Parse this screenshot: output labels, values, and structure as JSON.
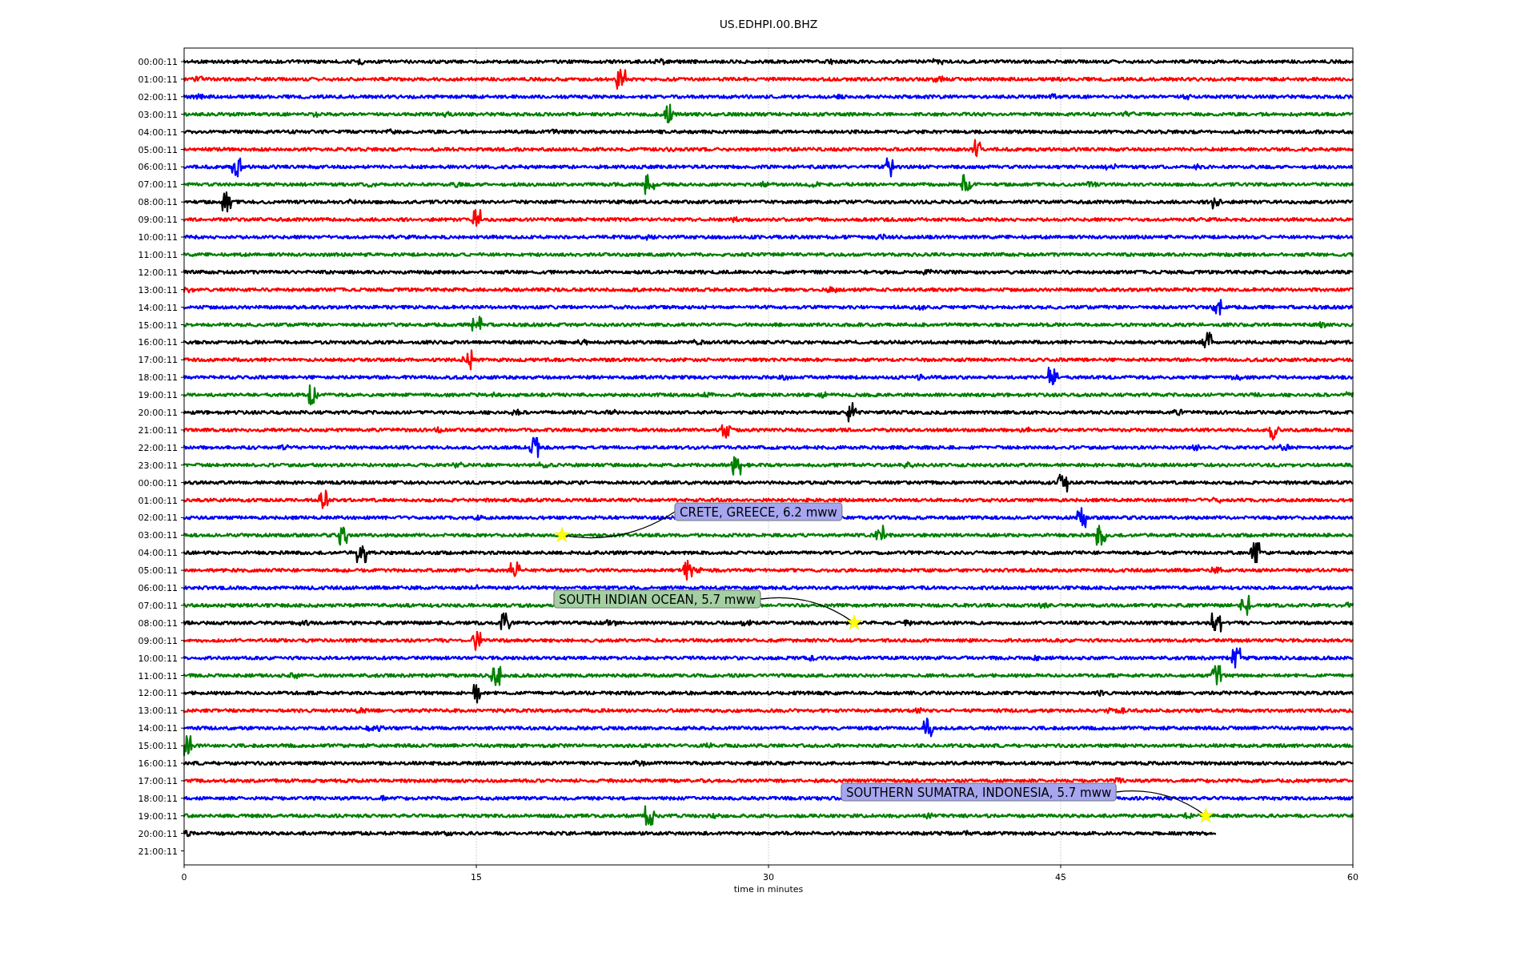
{
  "plot": {
    "title": "US.EDHPI.00.BHZ",
    "xlabel": "time in minutes",
    "xticks": [
      "0",
      "15",
      "30",
      "45",
      "60"
    ],
    "rows": [
      {
        "label": "00:00:11",
        "color": "#000000",
        "level": 1
      },
      {
        "label": "01:00:11",
        "color": "#ff0000",
        "level": 1
      },
      {
        "label": "02:00:11",
        "color": "#0000ff",
        "level": 1
      },
      {
        "label": "03:00:11",
        "color": "#008000",
        "level": 1
      },
      {
        "label": "04:00:11",
        "color": "#000000",
        "level": 1
      },
      {
        "label": "05:00:11",
        "color": "#ff0000",
        "level": 1
      },
      {
        "label": "06:00:11",
        "color": "#0000ff",
        "level": 1
      },
      {
        "label": "07:00:11",
        "color": "#008000",
        "level": 1
      },
      {
        "label": "08:00:11",
        "color": "#000000",
        "level": 1
      },
      {
        "label": "09:00:11",
        "color": "#ff0000",
        "level": 1
      },
      {
        "label": "10:00:11",
        "color": "#0000ff",
        "level": 1
      },
      {
        "label": "11:00:11",
        "color": "#008000",
        "level": 1
      },
      {
        "label": "12:00:11",
        "color": "#000000",
        "level": 1
      },
      {
        "label": "13:00:11",
        "color": "#ff0000",
        "level": 1
      },
      {
        "label": "14:00:11",
        "color": "#0000ff",
        "level": 1
      },
      {
        "label": "15:00:11",
        "color": "#008000",
        "level": 1
      },
      {
        "label": "16:00:11",
        "color": "#000000",
        "level": 1
      },
      {
        "label": "17:00:11",
        "color": "#ff0000",
        "level": 1
      },
      {
        "label": "18:00:11",
        "color": "#0000ff",
        "level": 1
      },
      {
        "label": "19:00:11",
        "color": "#008000",
        "level": 1
      },
      {
        "label": "20:00:11",
        "color": "#000000",
        "level": 1
      },
      {
        "label": "21:00:11",
        "color": "#ff0000",
        "level": 1
      },
      {
        "label": "22:00:11",
        "color": "#0000ff",
        "level": 1
      },
      {
        "label": "23:00:11",
        "color": "#008000",
        "level": 1
      },
      {
        "label": "00:00:11",
        "color": "#000000",
        "level": 1
      },
      {
        "label": "01:00:11",
        "color": "#ff0000",
        "level": 1
      },
      {
        "label": "02:00:11",
        "color": "#0000ff",
        "level": 1
      },
      {
        "label": "03:00:11",
        "color": "#008000",
        "level": 1
      },
      {
        "label": "04:00:11",
        "color": "#000000",
        "level": 1
      },
      {
        "label": "05:00:11",
        "color": "#ff0000",
        "level": 1
      },
      {
        "label": "06:00:11",
        "color": "#0000ff",
        "level": 1
      },
      {
        "label": "07:00:11",
        "color": "#008000",
        "level": 1
      },
      {
        "label": "08:00:11",
        "color": "#000000",
        "level": 1
      },
      {
        "label": "09:00:11",
        "color": "#ff0000",
        "level": 1
      },
      {
        "label": "10:00:11",
        "color": "#0000ff",
        "level": 1
      },
      {
        "label": "11:00:11",
        "color": "#008000",
        "level": 1
      },
      {
        "label": "12:00:11",
        "color": "#000000",
        "level": 1
      },
      {
        "label": "13:00:11",
        "color": "#ff0000",
        "level": 1
      },
      {
        "label": "14:00:11",
        "color": "#0000ff",
        "level": 1
      },
      {
        "label": "15:00:11",
        "color": "#008000",
        "level": 1
      },
      {
        "label": "16:00:11",
        "color": "#000000",
        "level": 1
      },
      {
        "label": "17:00:11",
        "color": "#ff0000",
        "level": 1
      },
      {
        "label": "18:00:11",
        "color": "#0000ff",
        "level": 1
      },
      {
        "label": "19:00:11",
        "color": "#008000",
        "level": 1
      },
      {
        "label": "20:00:11",
        "color": "#000000",
        "level": 0.883
      },
      {
        "label": "21:00:11"
      }
    ],
    "events": [
      {
        "label": "CRETE, GREECE, 6.2 mww",
        "color": "#a6a6f0"
      },
      {
        "label": "SOUTH INDIAN OCEAN, 5.7 mww",
        "color": "#a3cfa3"
      },
      {
        "label": "SOUTHERN SUMATRA, INDONESIA, 5.7 mww",
        "color": "#a6a6f0"
      }
    ]
  }
}
